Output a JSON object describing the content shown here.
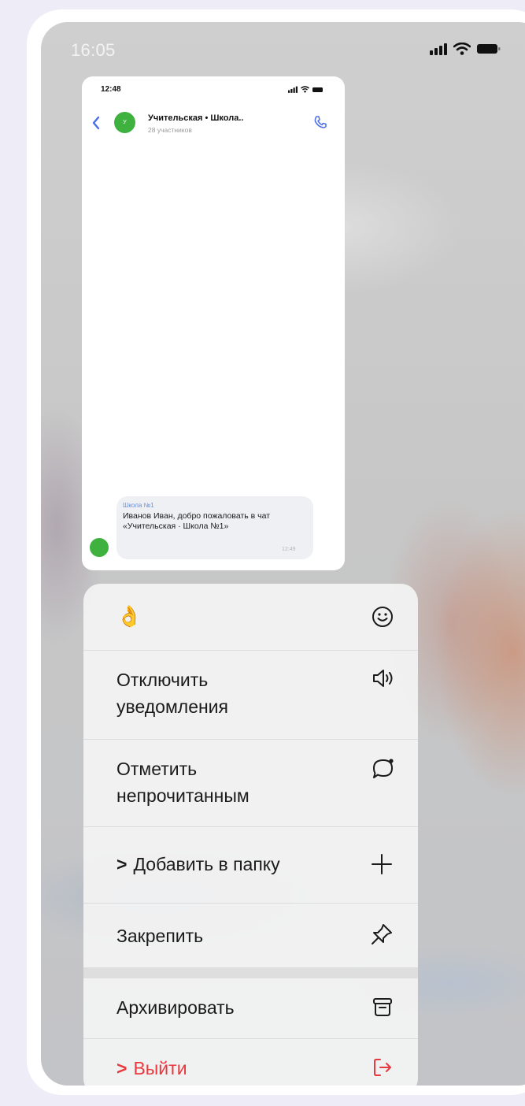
{
  "status_bar": {
    "time": "16:05"
  },
  "preview": {
    "status_time": "12:48",
    "chat_title": "Учительская • Школа..",
    "members": "28 участников",
    "avatar_letter": "У",
    "message": {
      "sender": "Школа №1",
      "text": "Иванов Иван, добро пожаловать в чат «Учительская · Школа №1»",
      "time": "12:49"
    }
  },
  "menu": {
    "reaction_emoji": "👌",
    "items": [
      {
        "label": "Отключить\nуведомления",
        "icon": "speaker-icon"
      },
      {
        "label": "Отметить\nнепрочитанным",
        "icon": "chat-bubble-icon"
      },
      {
        "label": "Добавить в папку",
        "icon": "plus-icon",
        "prefix": ">"
      },
      {
        "label": "Закрепить",
        "icon": "pin-icon"
      },
      {
        "label": "Архивировать",
        "icon": "archive-icon"
      },
      {
        "label": "Выйти",
        "icon": "exit-icon",
        "prefix": ">",
        "color": "#e9383e"
      }
    ]
  }
}
